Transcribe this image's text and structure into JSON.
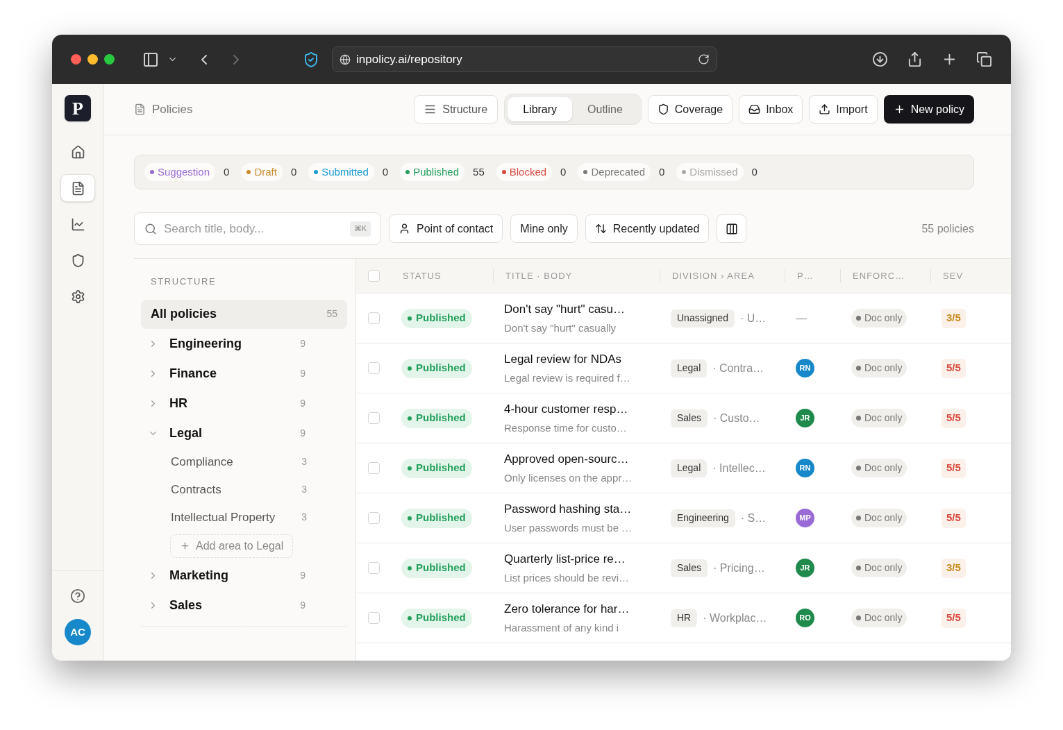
{
  "browser": {
    "url": "inpolicy.ai/repository"
  },
  "rail": {
    "logo": "P",
    "items": [
      {
        "selected": false
      },
      {
        "selected": true
      },
      {
        "selected": false
      },
      {
        "selected": false
      },
      {
        "selected": false
      }
    ],
    "avatar": "AC"
  },
  "header": {
    "breadcrumb": "Policies",
    "structure_button": "Structure",
    "views": [
      {
        "label": "Library",
        "selected": true
      },
      {
        "label": "Outline",
        "selected": false
      }
    ],
    "buttons": [
      "Coverage",
      "Inbox",
      "Import"
    ],
    "primary": "New policy"
  },
  "status_filters": [
    {
      "label": "Suggestion",
      "count": "0",
      "color": "#9b6bd6"
    },
    {
      "label": "Draft",
      "count": "0",
      "color": "#c98a2b"
    },
    {
      "label": "Submitted",
      "count": "0",
      "color": "#1a9bd7"
    },
    {
      "label": "Published",
      "count": "55",
      "color": "#22a05a"
    },
    {
      "label": "Blocked",
      "count": "0",
      "color": "#d9483b"
    },
    {
      "label": "Deprecated",
      "count": "0",
      "color": "#7a7a7a"
    },
    {
      "label": "Dismissed",
      "count": "0",
      "color": "#a8a8a8"
    }
  ],
  "toolbar": {
    "search": {
      "placeholder": "Search title, body...",
      "shortcut": "⌘K"
    },
    "filters": [
      "Point of contact",
      "Mine only",
      "Recently updated"
    ],
    "total": "55 policies"
  },
  "structure": {
    "title": "STRUCTURE",
    "all": {
      "label": "All policies",
      "count": "55",
      "selected": true
    },
    "divisions": [
      {
        "label": "Engineering",
        "count": "9",
        "expanded": false
      },
      {
        "label": "Finance",
        "count": "9",
        "expanded": false
      },
      {
        "label": "HR",
        "count": "9",
        "expanded": false
      },
      {
        "label": "Legal",
        "count": "9",
        "expanded": true,
        "children": [
          {
            "label": "Compliance",
            "count": "3"
          },
          {
            "label": "Contracts",
            "count": "3"
          },
          {
            "label": "Intellectual Property",
            "count": "3"
          }
        ],
        "add": "Add area to Legal"
      },
      {
        "label": "Marketing",
        "count": "9",
        "expanded": false
      },
      {
        "label": "Sales",
        "count": "9",
        "expanded": false
      }
    ]
  },
  "table": {
    "select_all": {
      "checked": false
    },
    "columns": [
      "STATUS",
      "TITLE · BODY",
      "DIVISION › AREA",
      "P…",
      "ENFORC…",
      "SEV"
    ],
    "rows": [
      {
        "checked": false,
        "status": "Published",
        "title": "Don't say \"hurt\" casu…",
        "body": "Don't say \"hurt\" casually",
        "division": "Unassigned",
        "area": "· U…",
        "owner": {
          "initials": "—"
        },
        "enforcement": "Doc only",
        "severity": {
          "label": "3/5",
          "color": "#c98a1b"
        }
      },
      {
        "checked": false,
        "status": "Published",
        "title": "Legal review for NDAs",
        "body": "Legal review is required f…",
        "division": "Legal",
        "area": "· Contra…",
        "owner": {
          "initials": "RN",
          "color": "#1788c9"
        },
        "enforcement": "Doc only",
        "severity": {
          "label": "5/5",
          "color": "#d9483b"
        }
      },
      {
        "checked": false,
        "status": "Published",
        "title": "4-hour customer resp…",
        "body": "Response time for custo…",
        "division": "Sales",
        "area": "· Custo…",
        "owner": {
          "initials": "JR",
          "color": "#1f8a4c"
        },
        "enforcement": "Doc only",
        "severity": {
          "label": "5/5",
          "color": "#d9483b"
        }
      },
      {
        "checked": false,
        "status": "Published",
        "title": "Approved open-sourc…",
        "body": "Only licenses on the appr…",
        "division": "Legal",
        "area": "· Intellec…",
        "owner": {
          "initials": "RN",
          "color": "#1788c9"
        },
        "enforcement": "Doc only",
        "severity": {
          "label": "5/5",
          "color": "#d9483b"
        }
      },
      {
        "checked": false,
        "status": "Published",
        "title": "Password hashing sta…",
        "body": "User passwords must be …",
        "division": "Engineering",
        "area": "· S…",
        "owner": {
          "initials": "MP",
          "color": "#9a6ad6"
        },
        "enforcement": "Doc only",
        "severity": {
          "label": "5/5",
          "color": "#d9483b"
        }
      },
      {
        "checked": false,
        "status": "Published",
        "title": "Quarterly list-price re…",
        "body": "List prices should be revi…",
        "division": "Sales",
        "area": "· Pricing…",
        "owner": {
          "initials": "JR",
          "color": "#1f8a4c"
        },
        "enforcement": "Doc only",
        "severity": {
          "label": "3/5",
          "color": "#c98a1b"
        }
      },
      {
        "checked": false,
        "status": "Published",
        "title": "Zero tolerance for har…",
        "body": "Harassment of any kind i",
        "division": "HR",
        "area": "· Workplac…",
        "owner": {
          "initials": "RO",
          "color": "#1f8a4c"
        },
        "enforcement": "Doc only",
        "severity": {
          "label": "5/5",
          "color": "#d9483b"
        }
      }
    ]
  }
}
